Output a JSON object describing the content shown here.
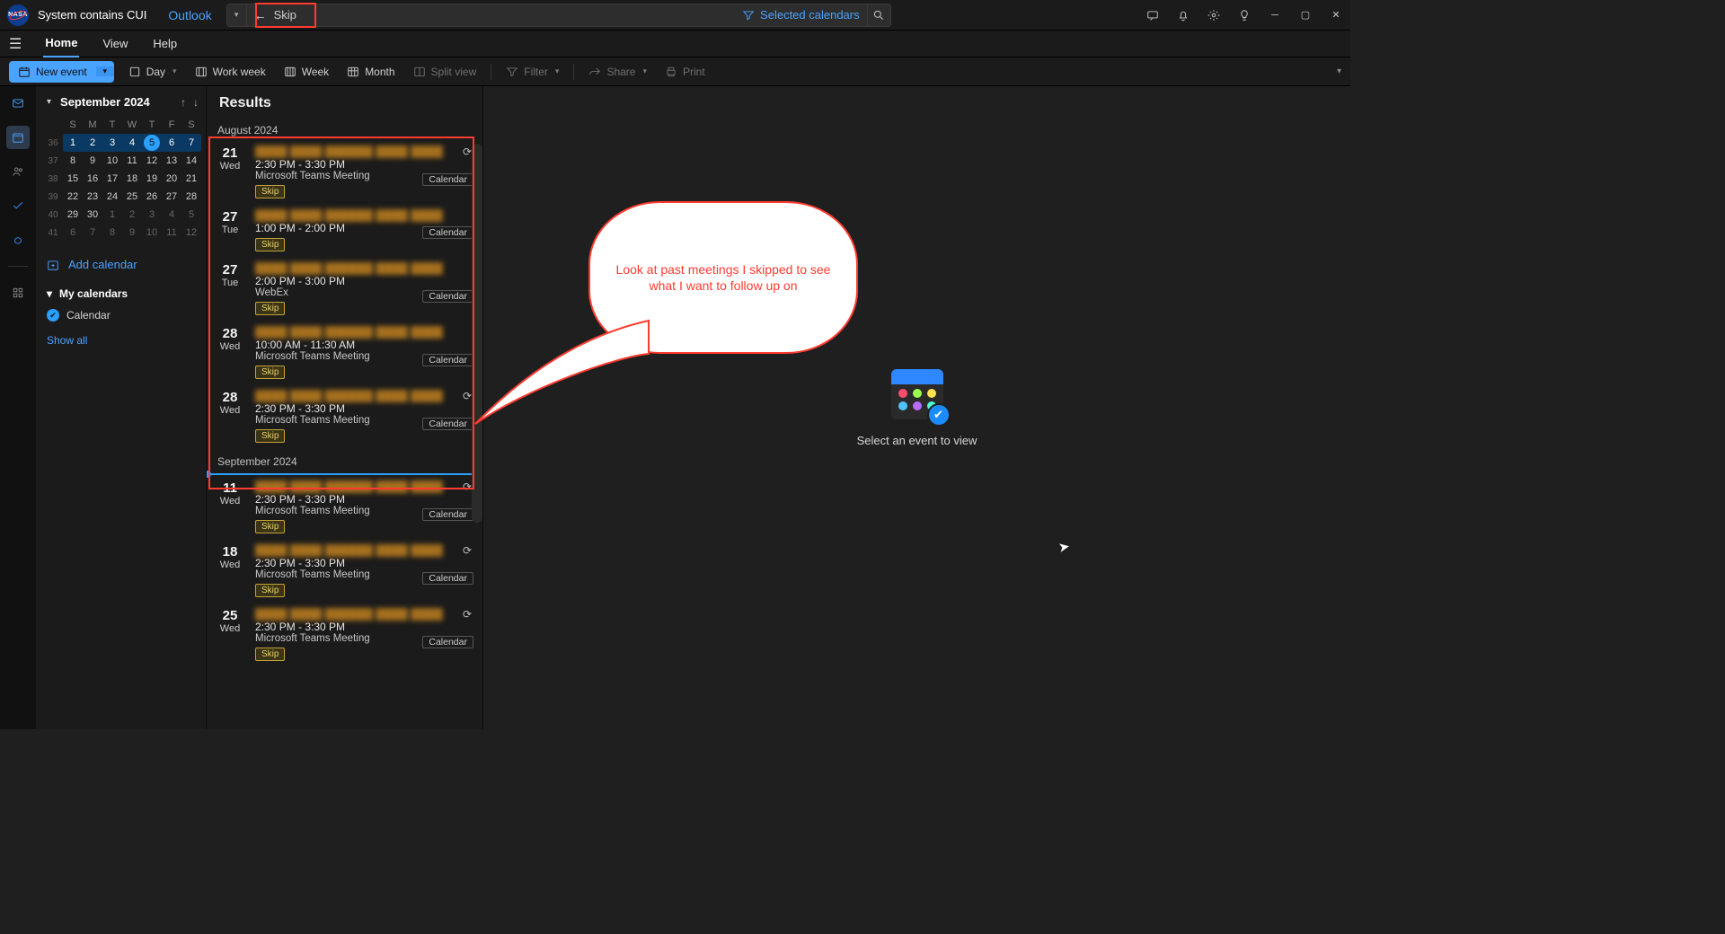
{
  "title_bar": {
    "cui_text": "System contains CUI",
    "app_name": "Outlook",
    "search_value": "Skip",
    "filter_label": "Selected calendars"
  },
  "tabs": {
    "home": "Home",
    "view": "View",
    "help": "Help"
  },
  "ribbon": {
    "new_event": "New event",
    "day": "Day",
    "work_week": "Work week",
    "week": "Week",
    "month": "Month",
    "split_view": "Split view",
    "filter": "Filter",
    "share": "Share",
    "print": "Print"
  },
  "sidebar": {
    "month_label": "September 2024",
    "dow": [
      "S",
      "M",
      "T",
      "W",
      "T",
      "F",
      "S"
    ],
    "weeks": [
      {
        "wk": "36",
        "days": [
          "1",
          "2",
          "3",
          "4",
          "5",
          "6",
          "7"
        ],
        "sel": true,
        "today_idx": 4
      },
      {
        "wk": "37",
        "days": [
          "8",
          "9",
          "10",
          "11",
          "12",
          "13",
          "14"
        ]
      },
      {
        "wk": "38",
        "days": [
          "15",
          "16",
          "17",
          "18",
          "19",
          "20",
          "21"
        ]
      },
      {
        "wk": "39",
        "days": [
          "22",
          "23",
          "24",
          "25",
          "26",
          "27",
          "28"
        ]
      },
      {
        "wk": "40",
        "days": [
          "29",
          "30",
          "1",
          "2",
          "3",
          "4",
          "5"
        ],
        "dim_from": 2
      },
      {
        "wk": "41",
        "days": [
          "6",
          "7",
          "8",
          "9",
          "10",
          "11",
          "12"
        ],
        "dim_from": 0
      }
    ],
    "add_calendar": "Add calendar",
    "my_cal_header": "My calendars",
    "cal_item": "Calendar",
    "show_all": "Show all"
  },
  "results": {
    "header": "Results",
    "months": [
      {
        "label": "August 2024",
        "events": [
          {
            "dnum": "21",
            "dname": "Wed",
            "time": "2:30 PM - 3:30 PM",
            "loc": "Microsoft Teams Meeting",
            "recur": true
          },
          {
            "dnum": "27",
            "dname": "Tue",
            "time": "1:00 PM - 2:00 PM",
            "loc": ""
          },
          {
            "dnum": "27",
            "dname": "Tue",
            "time": "2:00 PM - 3:00 PM",
            "loc": "WebEx"
          },
          {
            "dnum": "28",
            "dname": "Wed",
            "time": "10:00 AM - 11:30 AM",
            "loc": "Microsoft Teams Meeting"
          },
          {
            "dnum": "28",
            "dname": "Wed",
            "time": "2:30 PM - 3:30 PM",
            "loc": "Microsoft Teams Meeting",
            "recur": true
          }
        ]
      },
      {
        "label": "September 2024",
        "septline": true,
        "events": [
          {
            "dnum": "11",
            "dname": "Wed",
            "time": "2:30 PM - 3:30 PM",
            "loc": "Microsoft Teams Meeting",
            "recur": true
          },
          {
            "dnum": "18",
            "dname": "Wed",
            "time": "2:30 PM - 3:30 PM",
            "loc": "Microsoft Teams Meeting",
            "recur": true
          },
          {
            "dnum": "25",
            "dname": "Wed",
            "time": "2:30 PM - 3:30 PM",
            "loc": "Microsoft Teams Meeting",
            "recur": true
          }
        ]
      }
    ],
    "skip_tag": "Skip",
    "cal_badge": "Calendar"
  },
  "preview": {
    "empty_text": "Select an event to view"
  },
  "callout": {
    "text": "Look at past meetings I skipped to see what I want to follow up on"
  }
}
